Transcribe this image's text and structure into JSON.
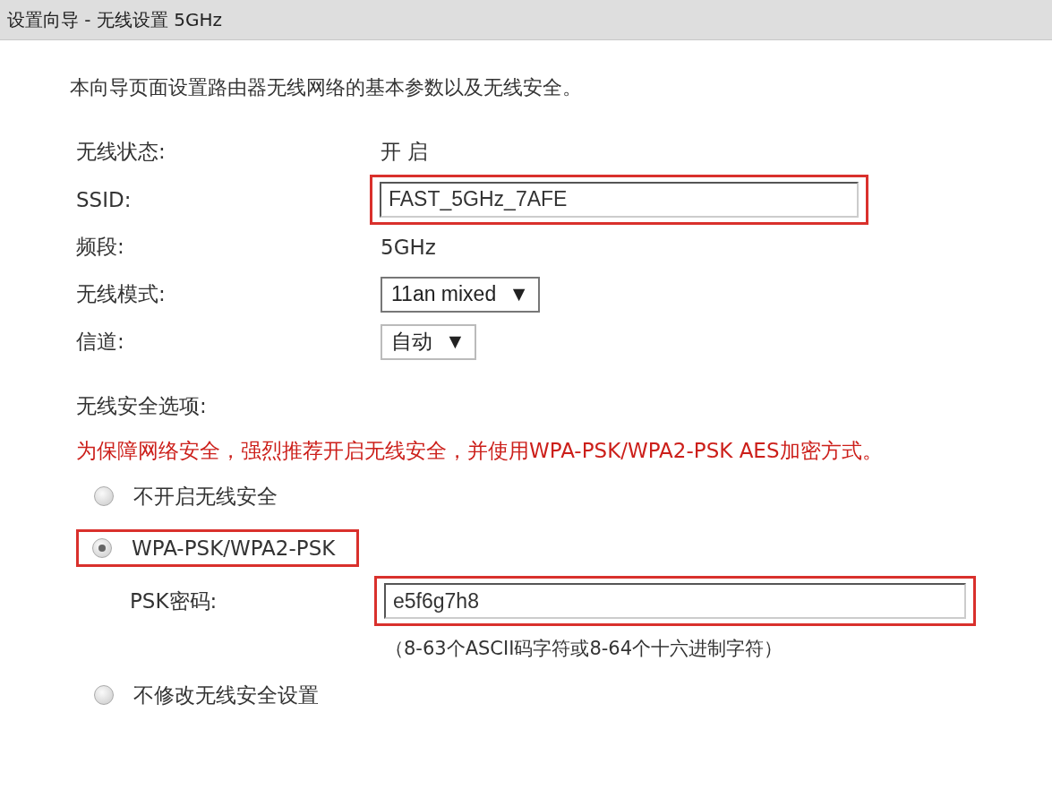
{
  "title_bar": {
    "title": "设置向导 - 无线设置 5GHz"
  },
  "intro": "本向导页面设置路由器无线网络的基本参数以及无线安全。",
  "fields": [
    {
      "kind": "text",
      "label": "无线状态:",
      "value": "开 启"
    },
    {
      "kind": "input",
      "label": "SSID:",
      "value": "FAST_5GHz_7AFE",
      "highlighted": true
    },
    {
      "kind": "text",
      "label": "频段:",
      "value": "5GHz"
    },
    {
      "kind": "select",
      "label": "无线模式:",
      "value": "11an mixed",
      "arrow": "▼"
    },
    {
      "kind": "select",
      "label": "信道:",
      "value": "自动",
      "arrow": "▼"
    }
  ],
  "security": {
    "label": "无线安全选项:",
    "warning": "为保障网络安全，强烈推荐开启无线安全，并使用WPA-PSK/WPA2-PSK AES加密方式。",
    "options": [
      {
        "label": "不开启无线安全",
        "selected": false,
        "highlighted": false
      },
      {
        "label": "WPA-PSK/WPA2-PSK",
        "selected": true,
        "highlighted": true,
        "password": {
          "label": "PSK密码:",
          "value": "e5f6g7h8",
          "highlighted": true,
          "hint": "（8-63个ASCII码字符或8-64个十六进制字符）"
        }
      },
      {
        "label": "不修改无线安全设置",
        "selected": false,
        "highlighted": false
      }
    ]
  }
}
